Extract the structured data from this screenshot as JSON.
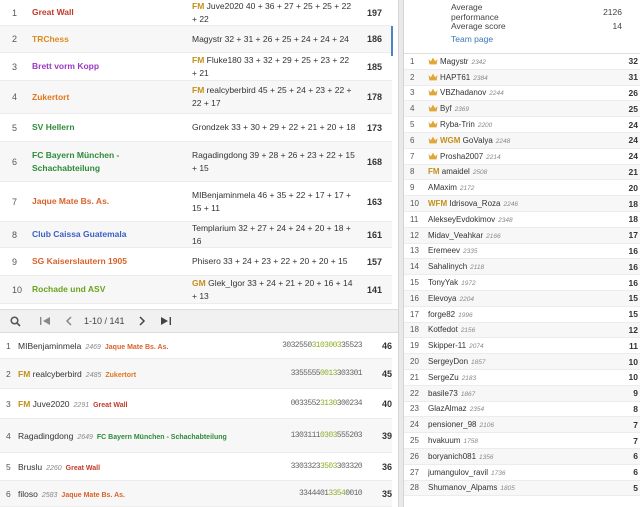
{
  "colors": {
    "title_gold": "#c5901a",
    "seq_highlight": "#8cb02a",
    "link_blue": "#3a78b8",
    "crown": "#e0a63a"
  },
  "teams": [
    {
      "rank": "1",
      "name": "Great Wall",
      "color": "#c0392b",
      "title": "FM",
      "players": "Juve2020 40 + 36 + 27 + 25 + 25 + 22 + 22",
      "score": "197"
    },
    {
      "rank": "2",
      "name": "TRChess",
      "color": "#e08a1e",
      "title": "",
      "players": "Magystr 32 + 31 + 26 + 25 + 24 + 24 + 24",
      "score": "186"
    },
    {
      "rank": "3",
      "name": "Brett vorm Kopp",
      "color": "#9b38c4",
      "title": "FM",
      "players": "Fluke180 33 + 32 + 29 + 25 + 23 + 22 + 21",
      "score": "185"
    },
    {
      "rank": "4",
      "name": "Zukertort",
      "color": "#e0761e",
      "title": "FM",
      "players": "realcyberbird 45 + 25 + 24 + 23 + 22 + 22 + 17",
      "score": "178"
    },
    {
      "rank": "5",
      "name": "SV Hellern",
      "color": "#2e8b3a",
      "title": "",
      "players": "Grondzek 33 + 30 + 29 + 22 + 21 + 20 + 18",
      "score": "173"
    },
    {
      "rank": "6",
      "name": "FC Bayern München - Schachabteilung",
      "color": "#2e8b3a",
      "title": "",
      "players": "Ragadingdong 39 + 28 + 26 + 23 + 22 + 15 + 15",
      "score": "168"
    },
    {
      "rank": "7",
      "name": "Jaque Mate Bs. As.",
      "color": "#d9622b",
      "title": "",
      "players": "MIBenjaminmela 46 + 35 + 22 + 17 + 17 + 15 + 11",
      "score": "163"
    },
    {
      "rank": "8",
      "name": "Club Caissa Guatemala",
      "color": "#3a5fc4",
      "title": "",
      "players": "Templarium 32 + 27 + 24 + 24 + 20 + 18 + 16",
      "score": "161"
    },
    {
      "rank": "9",
      "name": "SG Kaiserslautern 1905",
      "color": "#d9622b",
      "title": "",
      "players": "Phisero 33 + 24 + 23 + 22 + 20 + 20 + 15",
      "score": "157"
    },
    {
      "rank": "10",
      "name": "Rochade und ASV",
      "color": "#6aa31e",
      "title": "GM",
      "players": "Glek_Igor 33 + 24 + 21 + 20 + 16 + 14 + 13",
      "score": "141"
    }
  ],
  "pager": {
    "info": "1-10 / 141"
  },
  "players": [
    {
      "rank": "1",
      "title": "",
      "name": "MIBenjaminmela",
      "rating": "2469",
      "team": "Jaque Mate Bs. As.",
      "team_color": "#d9622b",
      "seq_a": "3032550",
      "seq_b": "3103003",
      "seq_c": "35523",
      "score": "46"
    },
    {
      "rank": "2",
      "title": "FM",
      "name": "realcyberbird",
      "rating": "2485",
      "team": "Zukertort",
      "team_color": "#e0761e",
      "seq_a": "3355555",
      "seq_b": "0013",
      "seq_c": "303301",
      "score": "45"
    },
    {
      "rank": "3",
      "title": "FM",
      "name": "Juve2020",
      "rating": "2291",
      "team": "Great Wall",
      "team_color": "#c0392b",
      "seq_a": "0033552",
      "seq_b": "3130",
      "seq_c": "300234",
      "score": "40"
    },
    {
      "rank": "4",
      "title": "",
      "name": "Ragadingdong",
      "rating": "2649",
      "team": "FC Bayern München - Schachabteilung",
      "team_color": "#2e8b3a",
      "seq_a": "1303111",
      "seq_b": "0303",
      "seq_c": "555203",
      "score": "39"
    },
    {
      "rank": "5",
      "title": "",
      "name": "Bruslu",
      "rating": "2260",
      "team": "Great Wall",
      "team_color": "#c0392b",
      "seq_a": "3303323",
      "seq_b": "3503",
      "seq_c": "303320",
      "score": "36"
    },
    {
      "rank": "6",
      "title": "",
      "name": "filoso",
      "rating": "2583",
      "team": "Jaque Mate Bs. As.",
      "team_color": "#d9622b",
      "seq_a": "3344401",
      "seq_b": "3354",
      "seq_c": "0010",
      "score": "35"
    }
  ],
  "stats": {
    "avg_perf_label": "Average performance",
    "avg_perf": "2126",
    "avg_score_label": "Average score",
    "avg_score": "14",
    "team_page": "Team page"
  },
  "roster": [
    {
      "rank": "1",
      "crown": true,
      "title": "",
      "name": "Magystr",
      "rating": "2342",
      "score": "32"
    },
    {
      "rank": "2",
      "crown": true,
      "title": "",
      "name": "HAPT61",
      "rating": "2384",
      "score": "31"
    },
    {
      "rank": "3",
      "crown": true,
      "title": "",
      "name": "VBZhadanov",
      "rating": "2244",
      "score": "26"
    },
    {
      "rank": "4",
      "crown": true,
      "title": "",
      "name": "Byf",
      "rating": "2369",
      "score": "25"
    },
    {
      "rank": "5",
      "crown": true,
      "title": "",
      "name": "Ryba-Trin",
      "rating": "2200",
      "score": "24"
    },
    {
      "rank": "6",
      "crown": true,
      "title": "WGM",
      "name": "GoValya",
      "rating": "2248",
      "score": "24"
    },
    {
      "rank": "7",
      "crown": true,
      "title": "",
      "name": "Prosha2007",
      "rating": "2214",
      "score": "24"
    },
    {
      "rank": "8",
      "crown": false,
      "title": "FM",
      "name": "amaidel",
      "rating": "2508",
      "score": "21"
    },
    {
      "rank": "9",
      "crown": false,
      "title": "",
      "name": "AMaxim",
      "rating": "2172",
      "score": "20"
    },
    {
      "rank": "10",
      "crown": false,
      "title": "WFM",
      "name": "Idrisova_Roza",
      "rating": "2246",
      "score": "18"
    },
    {
      "rank": "11",
      "crown": false,
      "title": "",
      "name": "AlekseyEvdokimov",
      "rating": "2348",
      "score": "18"
    },
    {
      "rank": "12",
      "crown": false,
      "title": "",
      "name": "Midav_Veahkar",
      "rating": "2166",
      "score": "17"
    },
    {
      "rank": "13",
      "crown": false,
      "title": "",
      "name": "Eremeev",
      "rating": "2335",
      "score": "16"
    },
    {
      "rank": "14",
      "crown": false,
      "title": "",
      "name": "Sahalinych",
      "rating": "2118",
      "score": "16"
    },
    {
      "rank": "15",
      "crown": false,
      "title": "",
      "name": "TonyYak",
      "rating": "1972",
      "score": "16"
    },
    {
      "rank": "16",
      "crown": false,
      "title": "",
      "name": "Elevoya",
      "rating": "2204",
      "score": "15"
    },
    {
      "rank": "17",
      "crown": false,
      "title": "",
      "name": "forge82",
      "rating": "1996",
      "score": "15"
    },
    {
      "rank": "18",
      "crown": false,
      "title": "",
      "name": "Kotfedot",
      "rating": "2156",
      "score": "12"
    },
    {
      "rank": "19",
      "crown": false,
      "title": "",
      "name": "Skipper-11",
      "rating": "2074",
      "score": "11"
    },
    {
      "rank": "20",
      "crown": false,
      "title": "",
      "name": "SergeyDon",
      "rating": "1857",
      "score": "10"
    },
    {
      "rank": "21",
      "crown": false,
      "title": "",
      "name": "SergeZu",
      "rating": "2183",
      "score": "10"
    },
    {
      "rank": "22",
      "crown": false,
      "title": "",
      "name": "basile73",
      "rating": "1867",
      "score": "9"
    },
    {
      "rank": "23",
      "crown": false,
      "title": "",
      "name": "GlazAlmaz",
      "rating": "2354",
      "score": "8"
    },
    {
      "rank": "24",
      "crown": false,
      "title": "",
      "name": "pensioner_98",
      "rating": "2106",
      "score": "7"
    },
    {
      "rank": "25",
      "crown": false,
      "title": "",
      "name": "hvakuum",
      "rating": "1758",
      "score": "7"
    },
    {
      "rank": "26",
      "crown": false,
      "title": "",
      "name": "boryanich081",
      "rating": "1356",
      "score": "6"
    },
    {
      "rank": "27",
      "crown": false,
      "title": "",
      "name": "jumangulov_ravil",
      "rating": "1736",
      "score": "6"
    },
    {
      "rank": "28",
      "crown": false,
      "title": "",
      "name": "Shumanov_Alpams",
      "rating": "1805",
      "score": "5"
    }
  ]
}
